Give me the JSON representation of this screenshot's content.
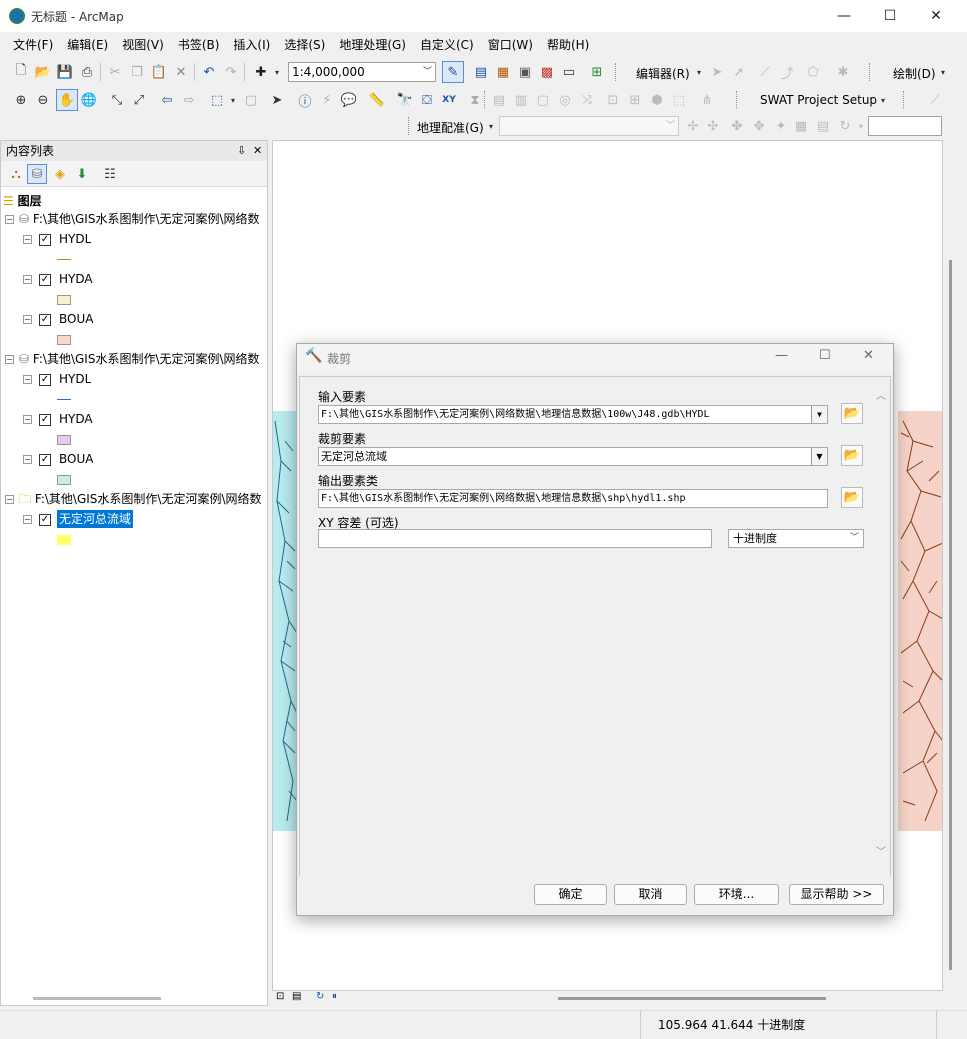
{
  "window": {
    "title": "无标题 - ArcMap",
    "minimize": "—",
    "maximize": "☐",
    "close": "✕"
  },
  "menu": [
    "文件(F)",
    "编辑(E)",
    "视图(V)",
    "书签(B)",
    "插入(I)",
    "选择(S)",
    "地理处理(G)",
    "自定义(C)",
    "窗口(W)",
    "帮助(H)"
  ],
  "toolbar": {
    "scale": "1:4,000,000",
    "editor_label": "编辑器(R)",
    "draw_label": "绘制(D)",
    "swat_label": "SWAT Project Setup",
    "georef_label": "地理配准(G)"
  },
  "toc": {
    "title": "内容列表",
    "pin": "⇩",
    "close": "✕",
    "root": "图层",
    "groups": [
      {
        "path": "F:\\其他\\GIS水系图制作\\无定河案例\\网络数",
        "layers": [
          {
            "name": "HYDL",
            "sym_type": "line",
            "color": "#c07a3a"
          },
          {
            "name": "HYDA",
            "sym_type": "fill",
            "color": "#f7f0cf"
          },
          {
            "name": "BOUA",
            "sym_type": "fill",
            "color": "#f9d7cf"
          }
        ]
      },
      {
        "path": "F:\\其他\\GIS水系图制作\\无定河案例\\网络数",
        "layers": [
          {
            "name": "HYDL",
            "sym_type": "line",
            "color": "#2a6fbe"
          },
          {
            "name": "HYDA",
            "sym_type": "fill",
            "color": "#e2c9f0"
          },
          {
            "name": "BOUA",
            "sym_type": "fill",
            "color": "#c9ecf2"
          }
        ]
      },
      {
        "path": "F:\\其他\\GIS水系图制作\\无定河案例\\网络数",
        "layers": [
          {
            "name": "无定河总流域",
            "sym_type": "fill",
            "color": "#ffff66",
            "selected": true
          }
        ]
      }
    ]
  },
  "dialog": {
    "title": "裁剪",
    "input_label": "输入要素",
    "input_value": "F:\\其他\\GIS水系图制作\\无定河案例\\网络数据\\地理信息数据\\100w\\J48.gdb\\HYDL",
    "clip_label": "裁剪要素",
    "clip_value": "无定河总流域",
    "output_label": "输出要素类",
    "output_value": "F:\\其他\\GIS水系图制作\\无定河案例\\网络数据\\地理信息数据\\shp\\hydl1.shp",
    "xy_label": "XY 容差 (可选)",
    "xy_value": "",
    "unit_value": "十进制度",
    "ok": "确定",
    "cancel": "取消",
    "env": "环境...",
    "help": "显示帮助 >>"
  },
  "status": {
    "coords": "105.964  41.644 十进制度"
  },
  "colors": {
    "selection": "#0078d7",
    "map_left": "#b9ecef",
    "map_right": "#f6d3c9",
    "river_left": "#1d6f86",
    "river_right": "#8a3b12"
  }
}
